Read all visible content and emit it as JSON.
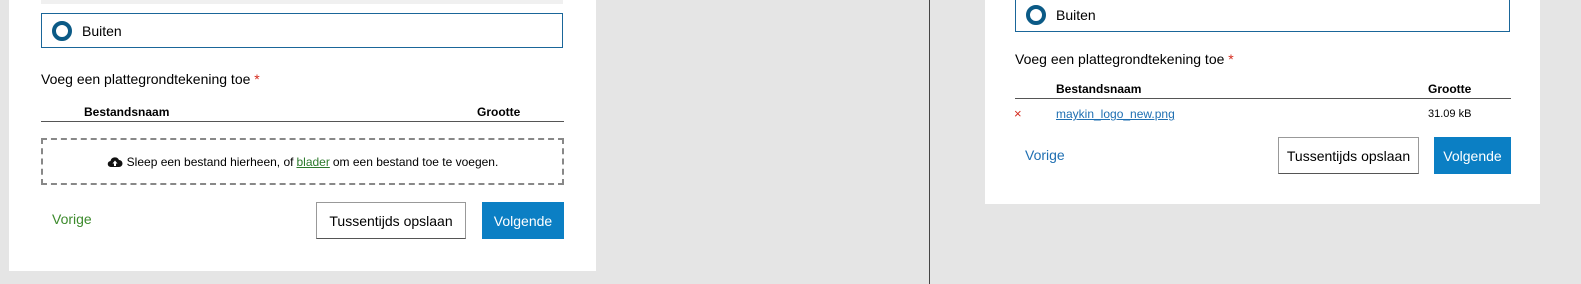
{
  "left": {
    "radio": {
      "label": "Buiten"
    },
    "field": {
      "label": "Voeg een plattegrondtekening toe",
      "required": "*"
    },
    "table": {
      "col_name": "Bestandsnaam",
      "col_size": "Grootte"
    },
    "dropzone": {
      "before": "Sleep een bestand hierheen, of",
      "link": "blader",
      "after": "om een bestand toe te voegen."
    },
    "nav": {
      "prev": "Vorige",
      "save": "Tussentijds opslaan",
      "next": "Volgende"
    }
  },
  "right": {
    "radio": {
      "label": "Buiten"
    },
    "field": {
      "label": "Voeg een plattegrondtekening toe",
      "required": "*"
    },
    "table": {
      "col_name": "Bestandsnaam",
      "col_size": "Grootte"
    },
    "file": {
      "remove_icon": "×",
      "name": "maykin_logo_new.png",
      "size": "31.09 kB"
    },
    "nav": {
      "prev": "Vorige",
      "save": "Tussentijds opslaan",
      "next": "Volgende"
    }
  },
  "colors": {
    "primary": "#0b7fc4",
    "prev_link_left": "#3c8a2c",
    "prev_link_right": "#1f6fb2",
    "required": "#d52b1e"
  }
}
